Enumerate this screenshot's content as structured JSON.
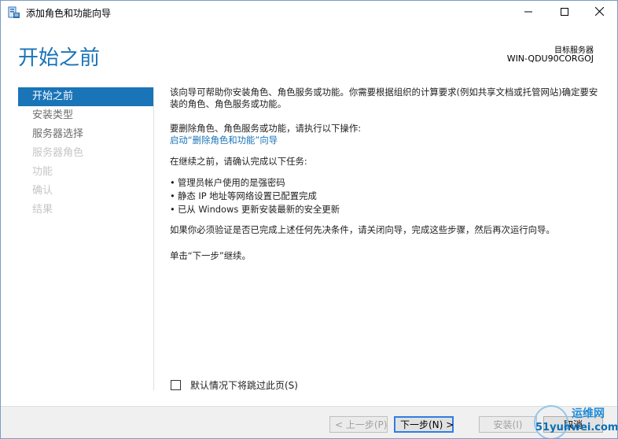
{
  "window": {
    "title": "添加角色和功能向导",
    "icon": "server-manager-icon",
    "controls": {
      "minimize": "minimize-icon",
      "maximize": "maximize-icon",
      "close": "close-icon"
    }
  },
  "header": {
    "title": "开始之前",
    "target_label": "目标服务器",
    "target_value": "WIN-QDU90CORGOJ"
  },
  "sidebar": {
    "items": [
      {
        "label": "开始之前",
        "state": "active"
      },
      {
        "label": "安装类型",
        "state": "enabled"
      },
      {
        "label": "服务器选择",
        "state": "enabled"
      },
      {
        "label": "服务器角色",
        "state": "disabled"
      },
      {
        "label": "功能",
        "state": "disabled"
      },
      {
        "label": "确认",
        "state": "disabled"
      },
      {
        "label": "结果",
        "state": "disabled"
      }
    ]
  },
  "content": {
    "intro": "该向导可帮助你安装角色、角色服务或功能。你需要根据组织的计算要求(例如共享文档或托管网站)确定要安装的角色、角色服务或功能。",
    "remove_text": "要删除角色、角色服务或功能，请执行以下操作:",
    "remove_link": "启动“删除角色和功能”向导",
    "before_text": "在继续之前，请确认完成以下任务:",
    "tasks": [
      "管理员帐户使用的是强密码",
      "静态 IP 地址等网络设置已配置完成",
      "已从 Windows 更新安装最新的安全更新"
    ],
    "verify_text": "如果你必须验证是否已完成上述任何先决条件，请关闭向导，完成这些步骤，然后再次运行向导。",
    "click_text": "单击“下一步”继续。"
  },
  "skip_checkbox": {
    "label": "默认情况下将跳过此页(S)",
    "checked": false
  },
  "buttons": {
    "prev": "< 上一步(P)",
    "next": "下一步(N) >",
    "install": "安装(I)",
    "cancel": "取消"
  },
  "watermark": {
    "top": "运维网",
    "bottom": "51yunwei.com"
  },
  "colors": {
    "accent": "#1a74b8",
    "footer_bg": "#f0f0f0",
    "disabled_text": "#c6c6c6"
  }
}
